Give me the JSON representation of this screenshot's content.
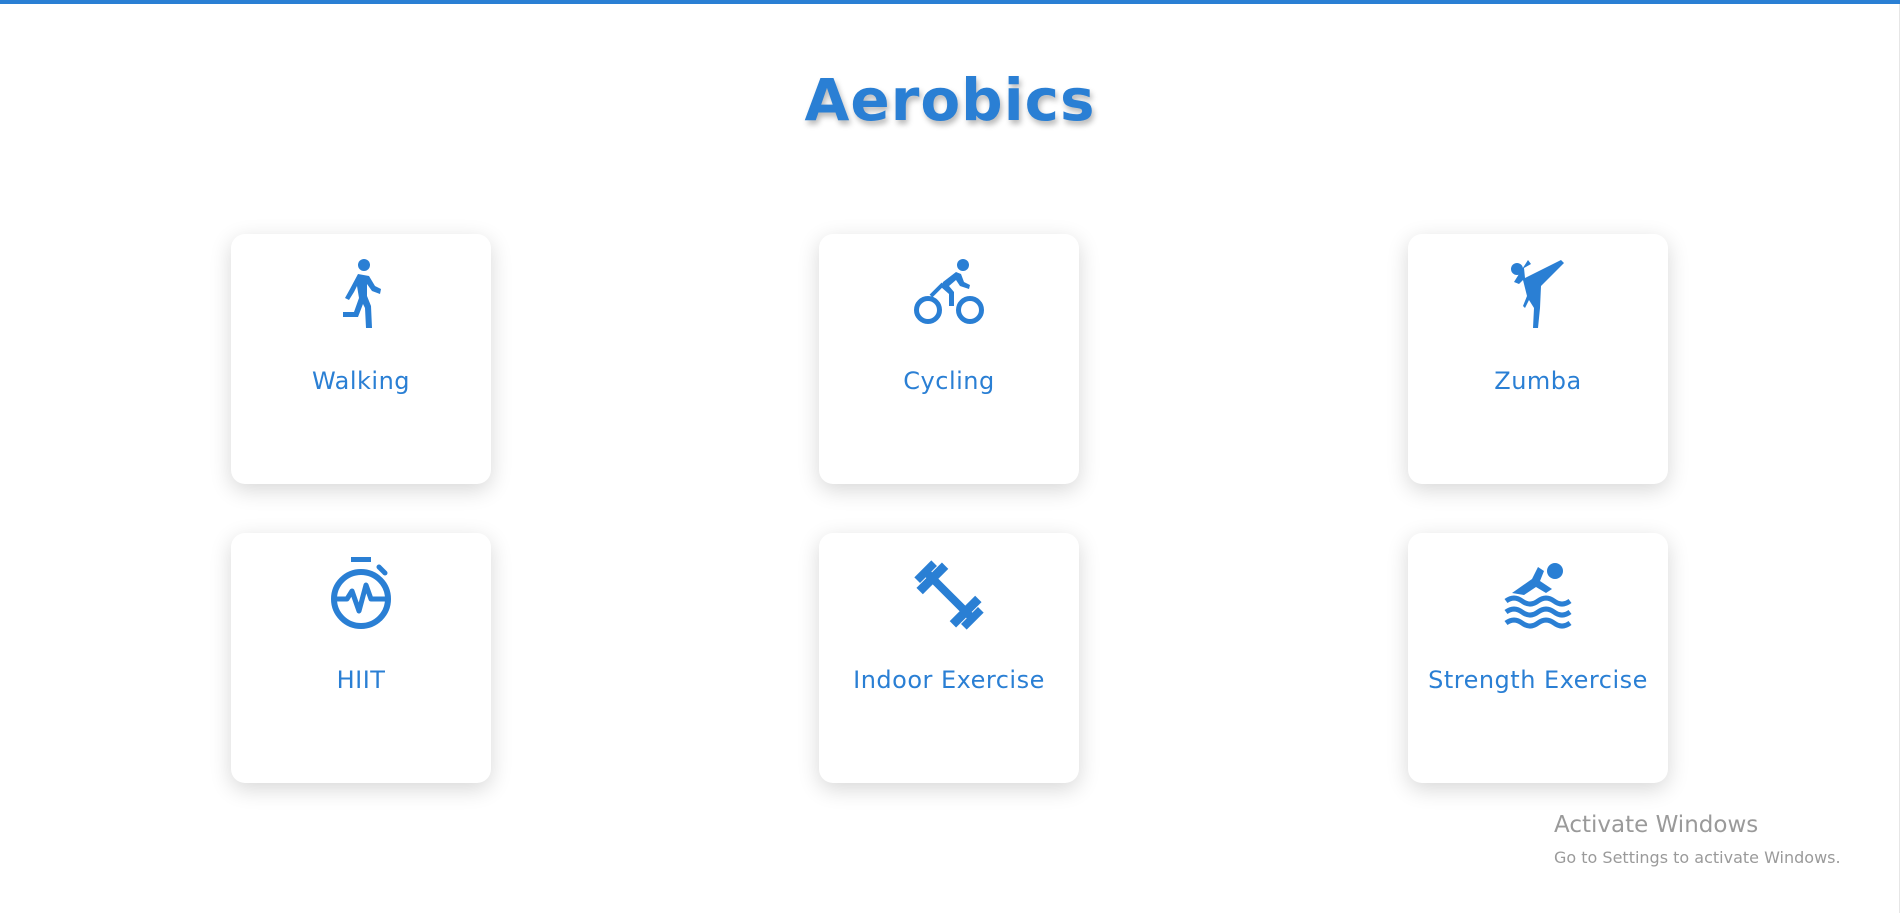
{
  "page": {
    "title": "Aerobics",
    "accent_color": "#2a7fd4"
  },
  "cards": [
    {
      "label": "Walking",
      "icon": "walking-icon"
    },
    {
      "label": "Cycling",
      "icon": "cycling-icon"
    },
    {
      "label": "Zumba",
      "icon": "martial-arts-kick-icon"
    },
    {
      "label": "HIIT",
      "icon": "stopwatch-heartbeat-icon"
    },
    {
      "label": "Indoor Exercise",
      "icon": "dumbbell-icon"
    },
    {
      "label": "Strength Exercise",
      "icon": "swimming-icon"
    }
  ],
  "watermark": {
    "line1": "Activate Windows",
    "line2": "Go to Settings to activate Windows."
  }
}
